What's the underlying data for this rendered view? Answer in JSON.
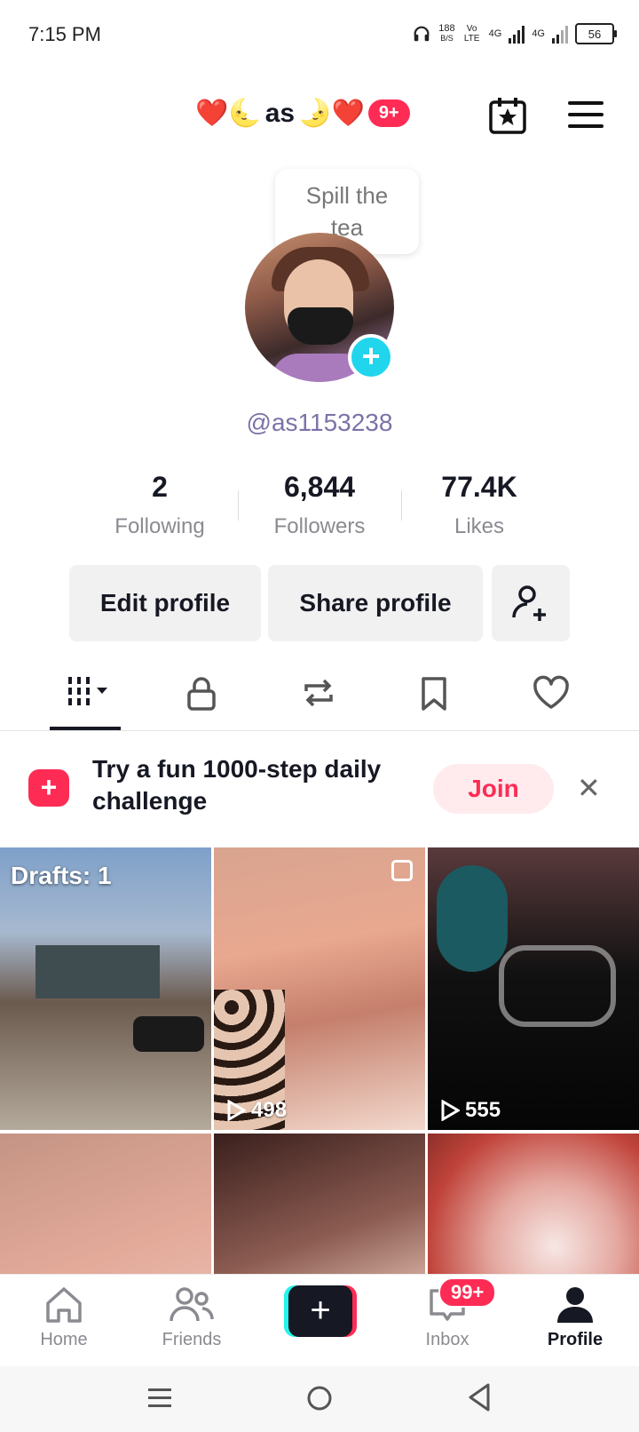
{
  "status_bar": {
    "time": "7:15 PM",
    "speed_value": "188",
    "speed_unit": "B/S",
    "volte": "Vo LTE",
    "net1": "4G",
    "net2": "4G",
    "battery": "56"
  },
  "header": {
    "title_emoji_left": "❤️🌜",
    "title_name": "as",
    "title_emoji_right": "🌛❤️",
    "notification_badge": "9+"
  },
  "bubble": {
    "line1": "Spill the",
    "line2": "tea"
  },
  "profile": {
    "handle": "@as1153238"
  },
  "stats": [
    {
      "value": "2",
      "label": "Following"
    },
    {
      "value": "6,844",
      "label": "Followers"
    },
    {
      "value": "77.4K",
      "label": "Likes"
    }
  ],
  "buttons": {
    "edit": "Edit profile",
    "share": "Share profile"
  },
  "challenge": {
    "text": "Try a fun 1000-step daily challenge",
    "join": "Join"
  },
  "grid": {
    "drafts": "Drafts: 1",
    "tiles": [
      {
        "views": ""
      },
      {
        "views": "498"
      },
      {
        "views": "555"
      }
    ]
  },
  "bottom_nav": {
    "home": "Home",
    "friends": "Friends",
    "inbox": "Inbox",
    "inbox_badge": "99+",
    "profile": "Profile"
  }
}
